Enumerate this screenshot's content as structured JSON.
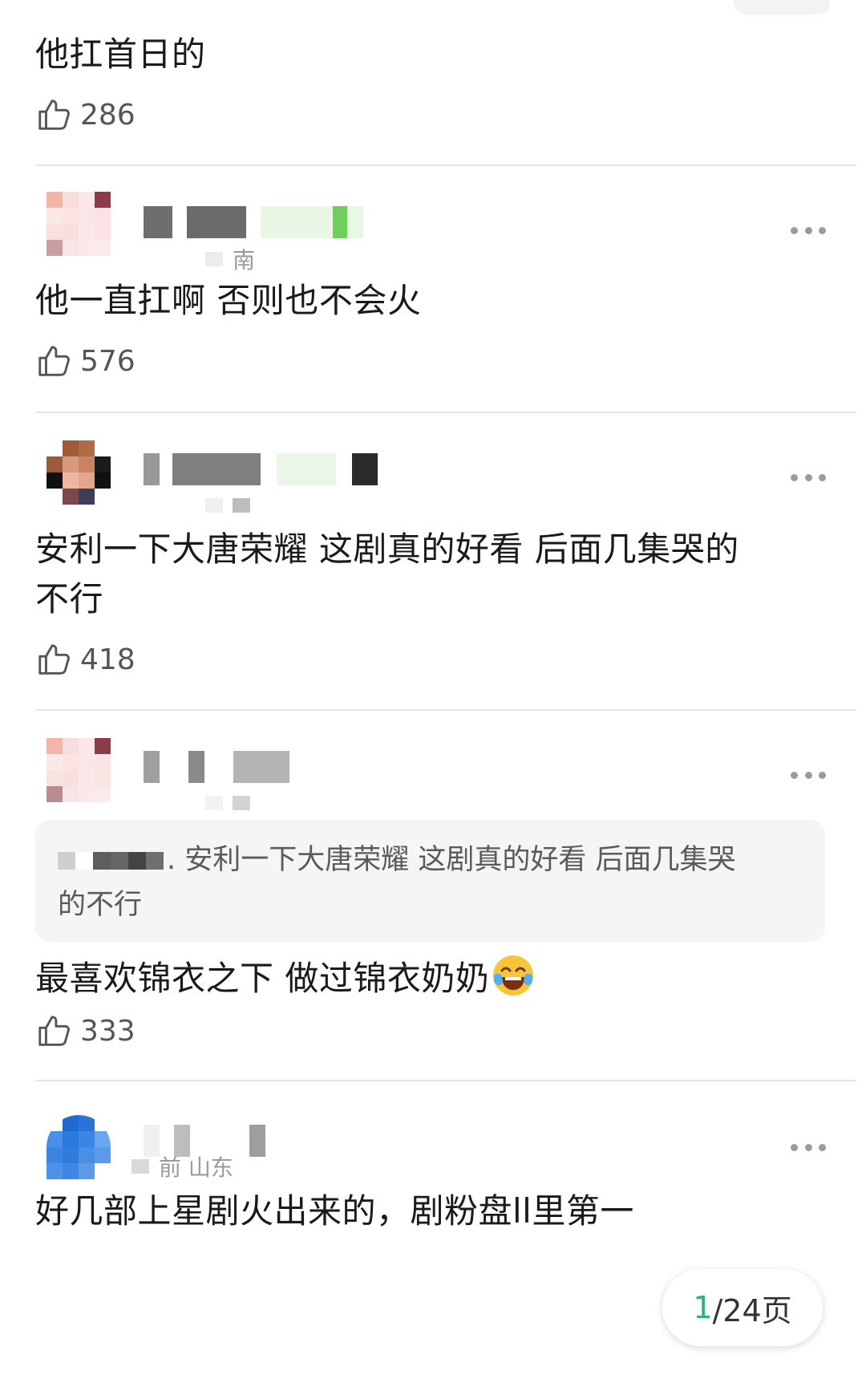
{
  "comments": [
    {
      "text": "他扛首日的",
      "likes": "286"
    },
    {
      "location_suffix": "南",
      "text": "他一直扛啊 否则也不会火",
      "likes": "576"
    },
    {
      "text_line1": "安利一下大唐荣耀 这剧真的好看 后面几集哭的",
      "text_line2": "不行",
      "likes": "418"
    },
    {
      "quote_line1": ". 安利一下大唐荣耀 这剧真的好看 后面几集哭",
      "quote_line2": "的不行",
      "text": "最喜欢锦衣之下 做过锦衣奶奶",
      "emoji": "laughing-crying-emoji",
      "likes": "333"
    },
    {
      "meta": "前 山东",
      "text": "好几部上星剧火出来的，剧粉盘ll里第一"
    }
  ],
  "icons": {
    "like": "thumbs-up-icon",
    "more": "more-dots-icon"
  },
  "pagination": {
    "current": "1",
    "rest": "/24页"
  },
  "colors": {
    "accent": "#2bb673",
    "text": "#1a1a1a",
    "muted": "#9a9a9a",
    "divider": "#e6e6e6"
  }
}
